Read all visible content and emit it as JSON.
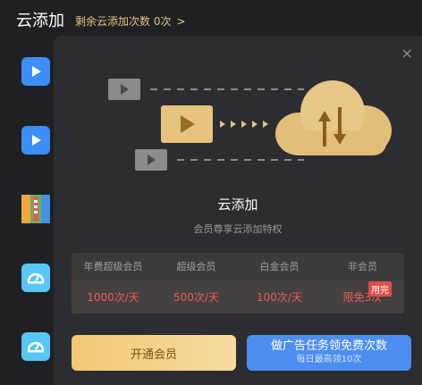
{
  "header": {
    "title": "云添加",
    "remaining_text": "剩余云添加次数 0次",
    "chevron": ">"
  },
  "sidebar": {
    "icons": [
      "play-icon",
      "play-icon",
      "archive-icon",
      "speed-icon",
      "speed-icon"
    ]
  },
  "dialog": {
    "close_label": "×",
    "title": "云添加",
    "subtitle": "会员尊享云添加特权",
    "table": {
      "headers": [
        "年费超级会员",
        "超级会员",
        "白金会员",
        "非会员"
      ],
      "values": [
        "1000次/天",
        "500次/天",
        "100次/天",
        "限免3次"
      ],
      "badge": "用完"
    },
    "buttons": {
      "vip_label": "开通会员",
      "ad_label": "做广告任务领免费次数",
      "ad_sublabel": "每日最高领10次"
    }
  },
  "colors": {
    "accent_gold": "#e7c27d",
    "accent_blue": "#4e8ef0",
    "alert_red": "#ee5d5d",
    "background": "#1f2024",
    "dialog_bg": "#2c2d31"
  }
}
